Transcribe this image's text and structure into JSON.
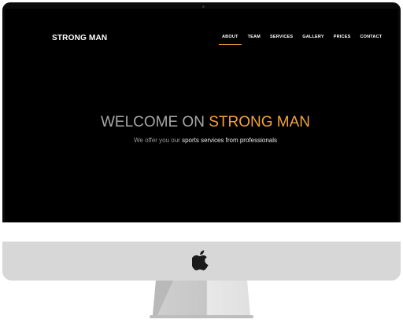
{
  "site": {
    "brand": "STRONG MAN",
    "nav": [
      {
        "label": "ABOUT",
        "active": true
      },
      {
        "label": "TEAM",
        "active": false
      },
      {
        "label": "SERVICES",
        "active": false
      },
      {
        "label": "GALLERY",
        "active": false
      },
      {
        "label": "PRICES",
        "active": false
      },
      {
        "label": "CONTACT",
        "active": false
      }
    ],
    "hero": {
      "title_part1": "WELCOME ON ",
      "title_part2": "STRONG MAN",
      "subtitle_part1": "We offer you our ",
      "subtitle_part2": "sports services from professionals"
    }
  },
  "colors": {
    "accent": "#f0a33a",
    "screen_bg": "#000000",
    "monitor_chin": "#d7d7d7"
  },
  "icons": {
    "chin_logo": "apple-logo-icon"
  }
}
